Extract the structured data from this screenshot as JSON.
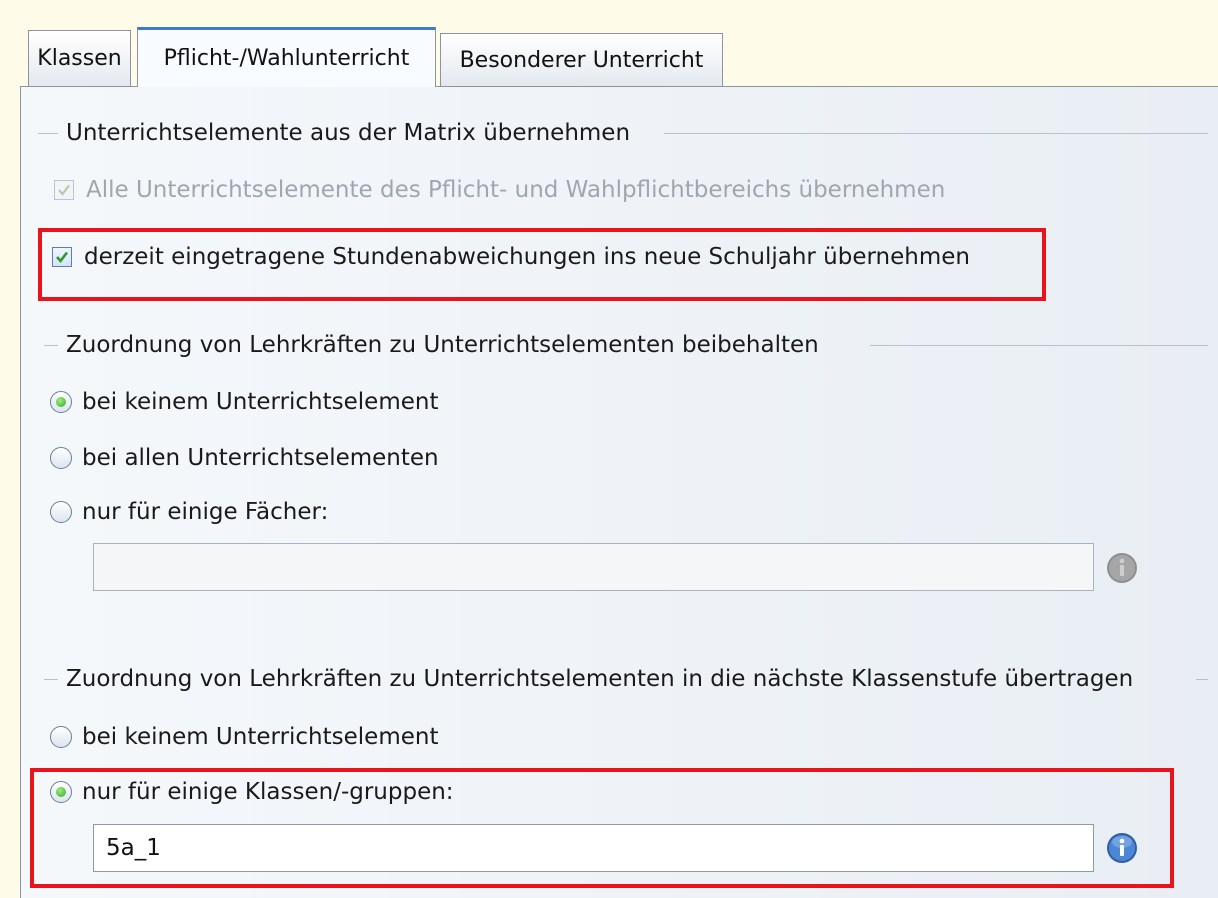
{
  "tabs": [
    {
      "label": "Klassen"
    },
    {
      "label": "Pflicht-/Wahlunterricht"
    },
    {
      "label": "Besonderer Unterricht"
    }
  ],
  "group1": {
    "title": "Unterrichtselemente aus der Matrix übernehmen",
    "option_all_label": "Alle Unterrichtselemente des Pflicht- und Wahlpflichtbereichs übernehmen",
    "option_all_checked": true,
    "option_all_enabled": false,
    "option_deviations_label": "derzeit eingetragene Stundenabweichungen ins neue Schuljahr übernehmen",
    "option_deviations_checked": true
  },
  "group2": {
    "title": "Zuordnung von Lehrkräften zu Unterrichtselementen beibehalten",
    "options": [
      {
        "label": "bei keinem Unterrichtselement",
        "selected": true
      },
      {
        "label": "bei allen Unterrichtselementen",
        "selected": false
      },
      {
        "label": "nur für einige Fächer:",
        "selected": false
      }
    ],
    "subjects_value": ""
  },
  "group3": {
    "title": "Zuordnung von Lehrkräften zu Unterrichtselementen in die nächste Klassenstufe übertragen",
    "options": [
      {
        "label": "bei keinem Unterrichtselement",
        "selected": false
      },
      {
        "label": "nur für einige Klassen/-gruppen:",
        "selected": true
      }
    ],
    "classes_value": "5a_1"
  },
  "icons": {
    "info_disabled": "info-icon",
    "info": "info-icon"
  },
  "colors": {
    "highlight": "#e8141c",
    "active_tab_accent": "#3f7ad2",
    "info_blue": "#3b74c8",
    "background": "#fefbe8"
  }
}
